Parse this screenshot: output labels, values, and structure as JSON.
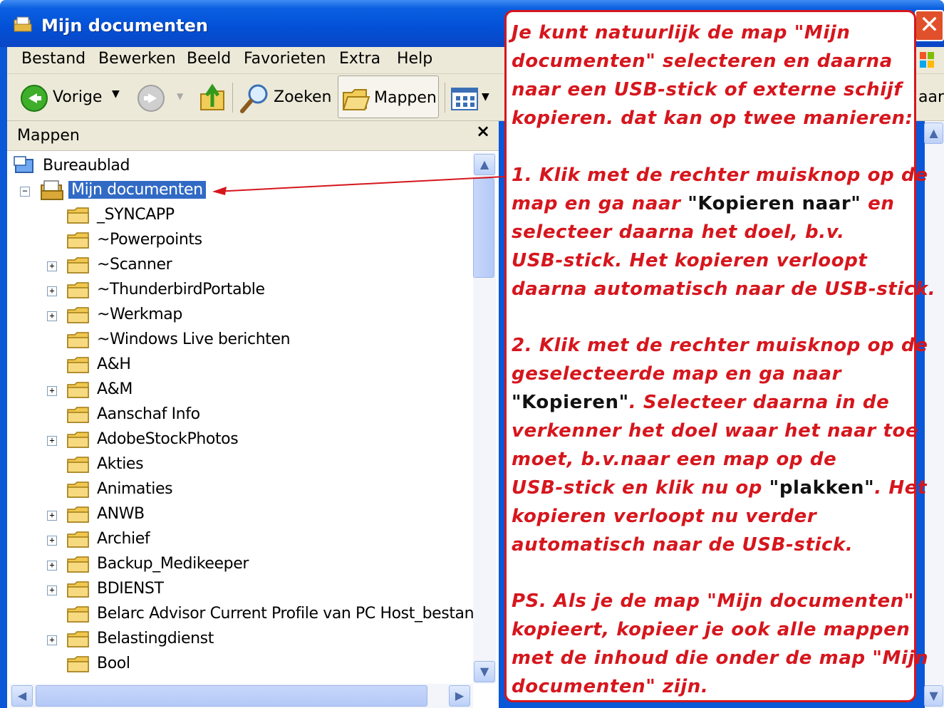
{
  "window": {
    "title": "Mijn documenten",
    "close_glyph": "✕"
  },
  "menu": {
    "items": [
      "Bestand",
      "Bewerken",
      "Beeld",
      "Favorieten",
      "Extra",
      "Help"
    ]
  },
  "toolbar": {
    "back_label": "Vorige",
    "search_label": "Zoeken",
    "folders_label": "Mappen",
    "cut_off_label": "aar"
  },
  "panel": {
    "title": "Mappen",
    "close_glyph": "×"
  },
  "tree": {
    "root": "Bureaublad",
    "selected": "Mijn documenten",
    "expander_plus": "+",
    "expander_minus": "−",
    "folders": [
      "_SYNCAPP",
      "~Powerpoints",
      "~Scanner",
      "~ThunderbirdPortable",
      "~Werkmap",
      "~Windows Live berichten",
      "A&H",
      "A&M",
      "Aanschaf Info",
      "AdobeStockPhotos",
      "Akties",
      "Animaties",
      "ANWB",
      "Archief",
      "Backup_Medikeeper",
      "BDIENST",
      "Belarc Advisor Current Profile van PC Host_bestande",
      "Belastingdienst",
      "Bool"
    ]
  },
  "callout": {
    "p1": [
      "Je kunt natuurlijk de map \"Mijn",
      "documenten\" selecteren en daarna",
      "naar een USB-stick of externe schijf",
      "kopieren. dat kan op twee manieren:"
    ],
    "p2_l1": "1. Klik met de rechter muisknop op de",
    "p2_l2a": "map en ga naar ",
    "p2_l2b": "\"Kopieren naar\"",
    "p2_l2c": " en",
    "p2_rest": [
      "selecteer daarna het doel, b.v.",
      "USB-stick. Het kopieren verloopt",
      "daarna automatisch naar de USB-stick."
    ],
    "p3_l1": "2. Klik met de rechter muisknop op de",
    "p3_l2": "geselecteerde map en ga naar",
    "p3_l3a": "\"Kopieren\"",
    "p3_l3b": ". Selecteer daarna in de",
    "p3_l4": "verkenner het doel waar het naar toe",
    "p3_l5": "moet, b.v.naar een map op de",
    "p3_l6a": "USB-stick en klik nu op ",
    "p3_l6b": "\"plakken\"",
    "p3_l6c": ". Het",
    "p3_l7": "kopieren verloopt nu verder",
    "p3_l8": "automatisch naar de USB-stick.",
    "p4": [
      "PS. Als je de map \"Mijn documenten\"",
      "kopieert, kopieer je ook alle mappen",
      "met de inhoud die onder de map \"Mijn",
      "documenten\" zijn."
    ]
  },
  "colors": {
    "titlebar": "#0350d6",
    "callout_red": "#d6161d",
    "selection": "#316ac5",
    "chrome": "#ece9d8"
  },
  "icons": [
    "folder-icon",
    "desktop-icon",
    "my-documents-icon",
    "back-arrow-icon",
    "forward-arrow-icon",
    "up-folder-icon",
    "search-icon",
    "views-icon"
  ]
}
